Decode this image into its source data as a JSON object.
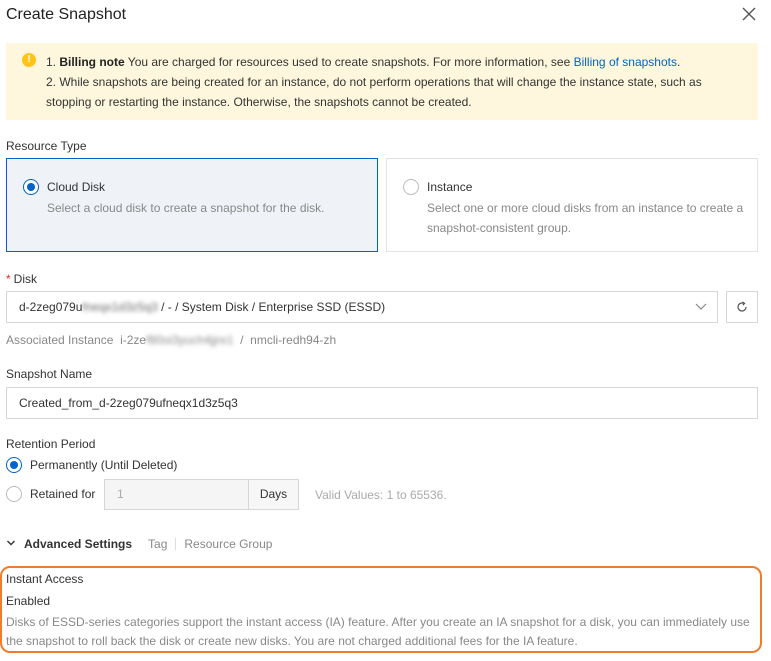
{
  "dialog": {
    "title": "Create Snapshot"
  },
  "notice": {
    "line1_prefix": "1. ",
    "billing_bold": "Billing note",
    "line1_text": " You are charged for resources used to create snapshots. For more information, see ",
    "billing_link": "Billing of snapshots",
    "line1_suffix": ".",
    "line2": "2. While snapshots are being created for an instance, do not perform operations that will change the instance state, such as stopping or restarting the instance. Otherwise, the snapshots cannot be created."
  },
  "resource_type": {
    "label": "Resource Type",
    "options": [
      {
        "title": "Cloud Disk",
        "desc": "Select a cloud disk to create a snapshot for the disk.",
        "selected": true
      },
      {
        "title": "Instance",
        "desc": "Select one or more cloud disks from an instance to create a snapshot-consistent group.",
        "selected": false
      }
    ]
  },
  "disk": {
    "required_mark": "*",
    "label": "Disk",
    "value_prefix": "d-2zeg079u",
    "value_hidden": "fneqx1d3z5q3",
    "value_suffix": " / - / System Disk / Enterprise SSD (ESSD)",
    "assoc_label": "Associated Instance",
    "assoc_prefix": "i-2ze",
    "assoc_hidden": "f80oi3yuch4jjre1",
    "assoc_suffix": "  /  nmcli-redh94-zh"
  },
  "snapshot_name": {
    "label": "Snapshot Name",
    "value": "Created_from_d-2zeg079ufneqx1d3z5q3"
  },
  "retention": {
    "label": "Retention Period",
    "permanent_label": "Permanently (Until Deleted)",
    "retained_label": "Retained for",
    "days_value": "1",
    "days_unit": "Days",
    "hint": "Valid Values: 1 to 65536."
  },
  "advanced": {
    "title": "Advanced Settings",
    "tabs": [
      "Tag",
      "Resource Group"
    ]
  },
  "instant_access": {
    "title": "Instant Access",
    "status": "Enabled",
    "desc": "Disks of ESSD-series categories support the instant access (IA) feature. After you create an IA snapshot for a disk, you can immediately use the snapshot to roll back the disk or create new disks. You are not charged additional fees for the IA feature."
  },
  "colors": {
    "accent": "#0064c8",
    "warning": "#ffc31a",
    "highlight": "#f07c2e"
  }
}
